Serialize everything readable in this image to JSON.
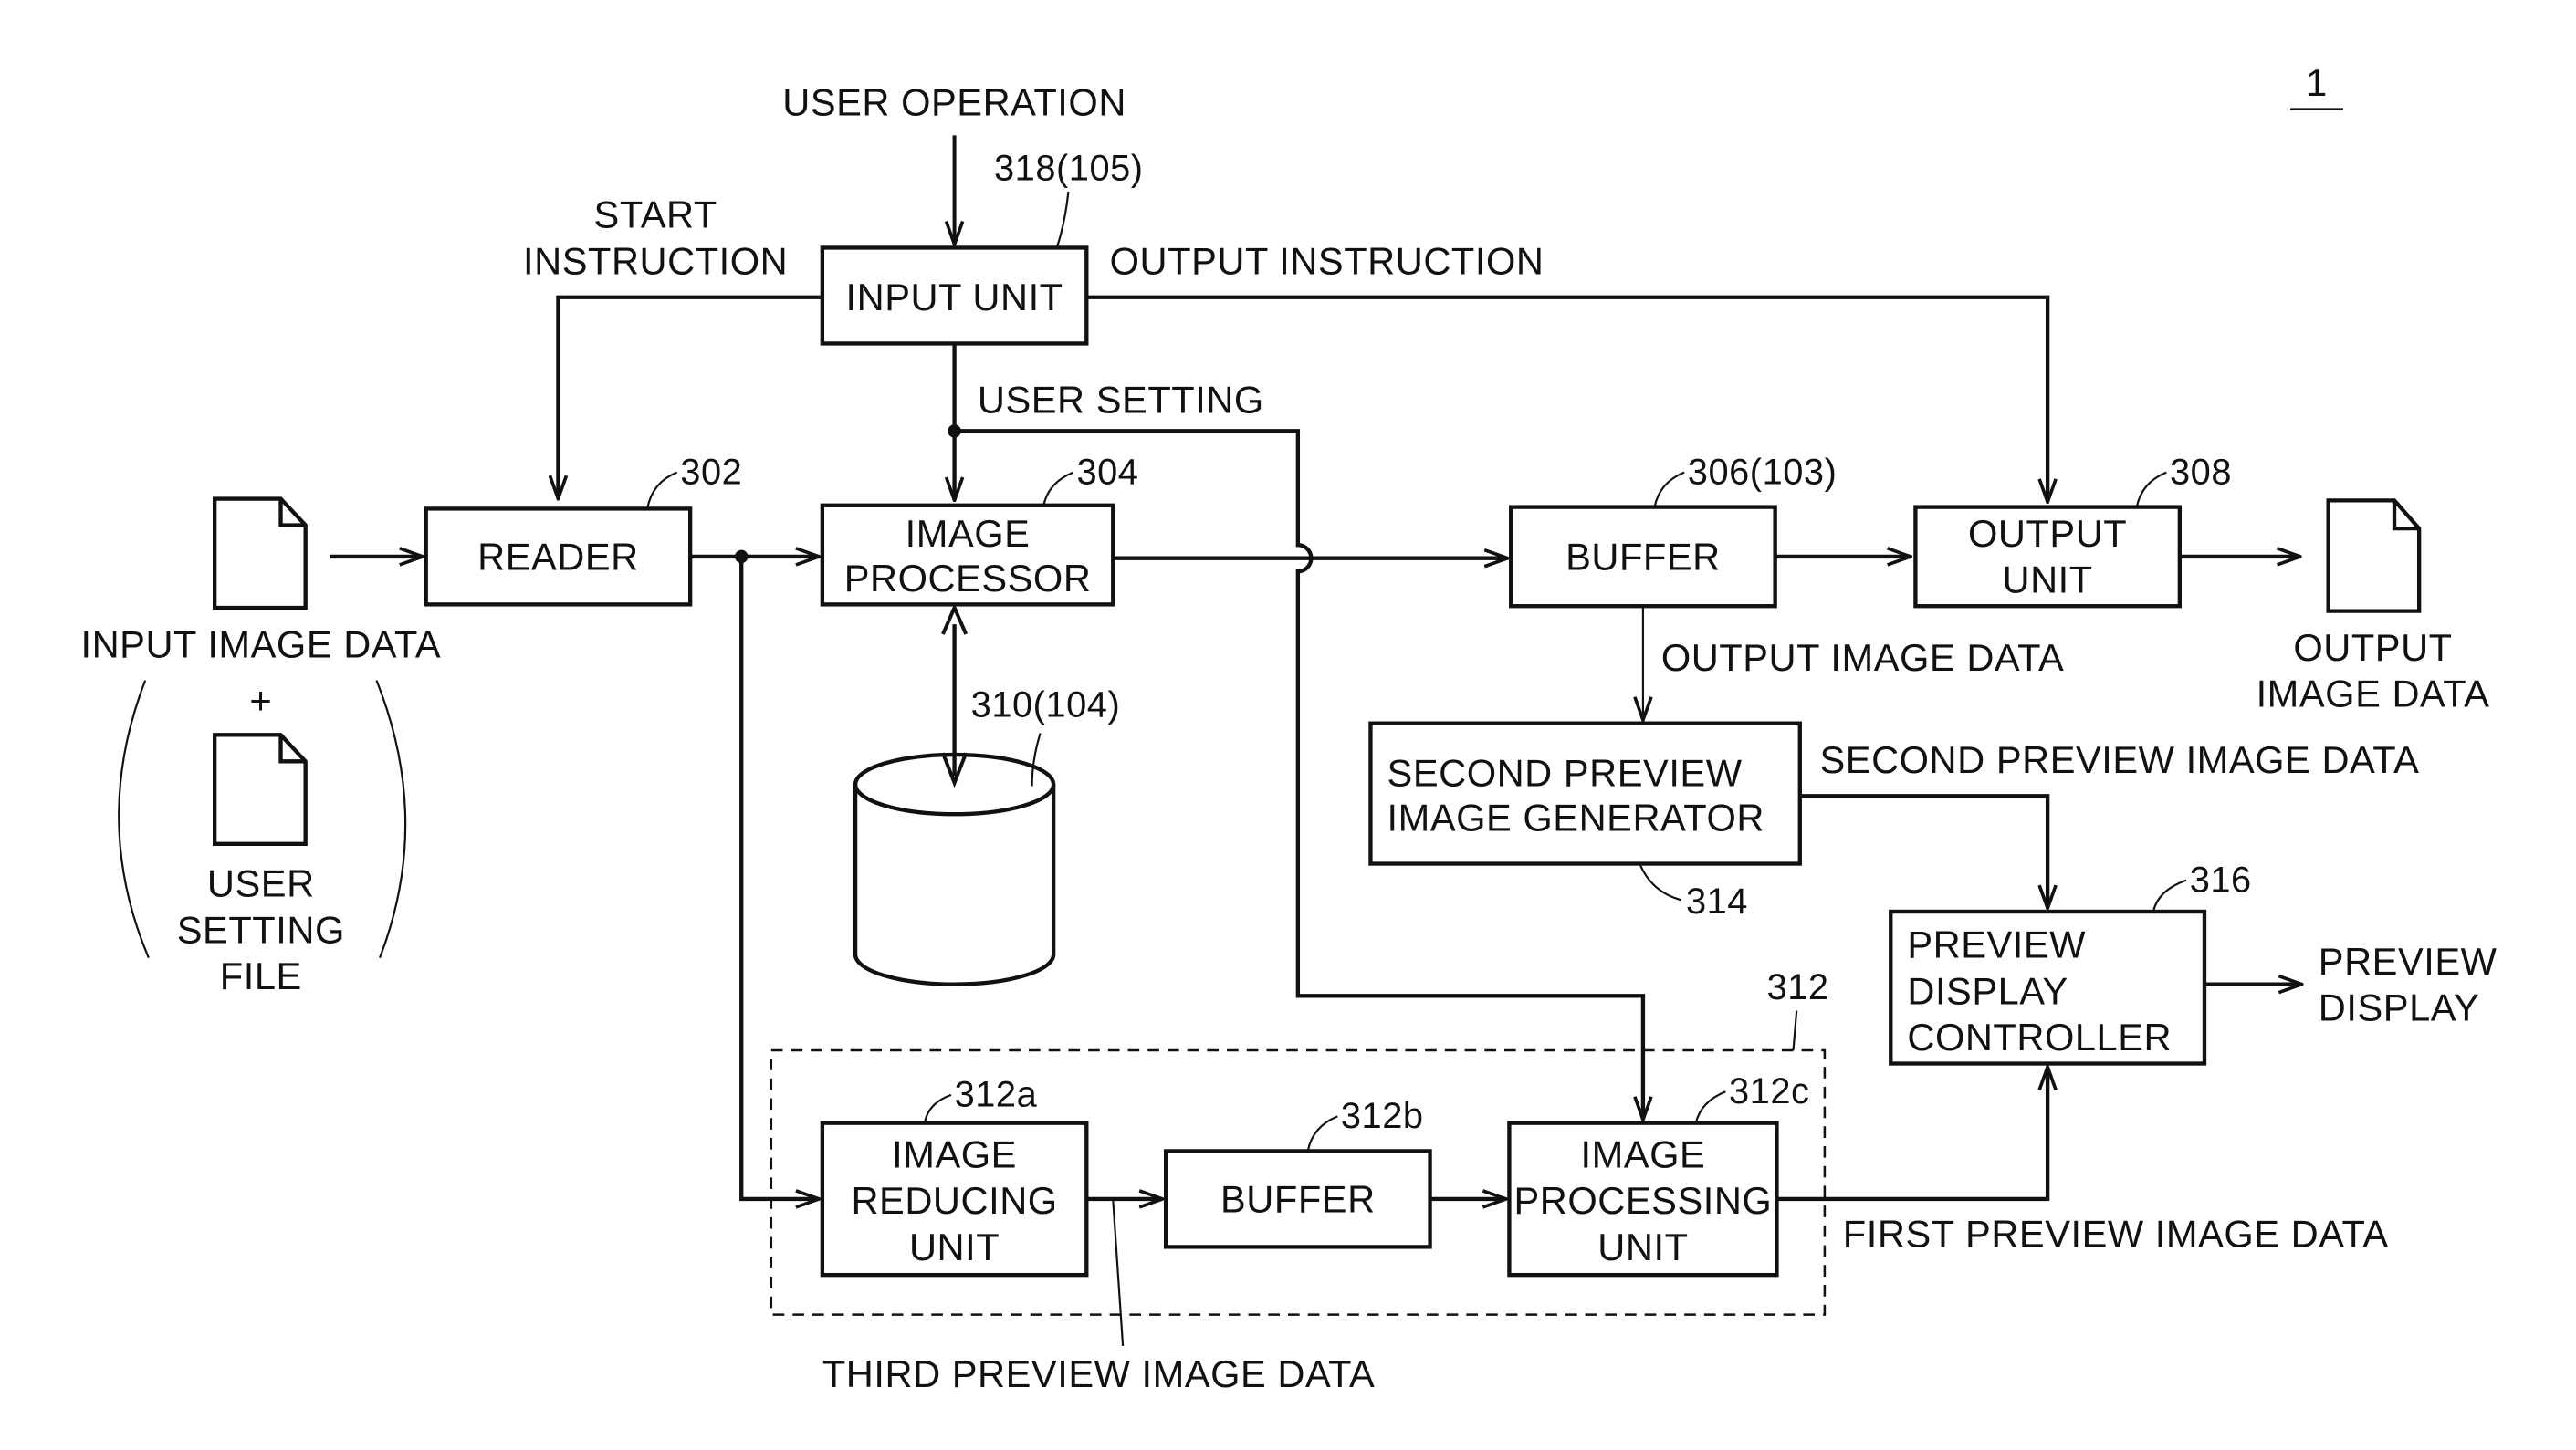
{
  "figure": {
    "label": "1",
    "external": {
      "user_operation": "USER OPERATION",
      "start_instruction": [
        "START",
        "INSTRUCTION"
      ],
      "output_instruction": "OUTPUT INSTRUCTION",
      "user_setting": "USER SETTING",
      "input_image_data": "INPUT IMAGE DATA",
      "plus": "+",
      "user_setting_file": [
        "USER",
        "SETTING",
        "FILE"
      ],
      "output_image_data_mid": "OUTPUT IMAGE DATA",
      "output_image_data_right": [
        "OUTPUT",
        "IMAGE DATA"
      ],
      "second_preview_image_data": "SECOND PREVIEW IMAGE DATA",
      "first_preview_image_data": "FIRST PREVIEW IMAGE DATA",
      "third_preview_image_data": "THIRD PREVIEW IMAGE DATA",
      "preview_display": [
        "PREVIEW",
        "DISPLAY"
      ]
    },
    "blocks": {
      "input_unit": {
        "ref": "318(105)",
        "lines": [
          "INPUT UNIT"
        ]
      },
      "reader": {
        "ref": "302",
        "lines": [
          "READER"
        ]
      },
      "image_processor": {
        "ref": "304",
        "lines": [
          "IMAGE",
          "PROCESSOR"
        ]
      },
      "storage": {
        "ref": "310(104)"
      },
      "buffer": {
        "ref": "306(103)",
        "lines": [
          "BUFFER"
        ]
      },
      "output_unit": {
        "ref": "308",
        "lines": [
          "OUTPUT",
          "UNIT"
        ]
      },
      "second_preview_generator": {
        "ref": "314",
        "lines": [
          "SECOND PREVIEW",
          "IMAGE GENERATOR"
        ]
      },
      "preview_display_controller": {
        "ref": "316",
        "lines": [
          "PREVIEW",
          "DISPLAY",
          "CONTROLLER"
        ]
      },
      "first_preview_group": {
        "ref": "312"
      },
      "image_reducing_unit": {
        "ref": "312a",
        "lines": [
          "IMAGE",
          "REDUCING",
          "UNIT"
        ]
      },
      "group_buffer": {
        "ref": "312b",
        "lines": [
          "BUFFER"
        ]
      },
      "image_processing_unit": {
        "ref": "312c",
        "lines": [
          "IMAGE",
          "PROCESSING",
          "UNIT"
        ]
      }
    }
  }
}
